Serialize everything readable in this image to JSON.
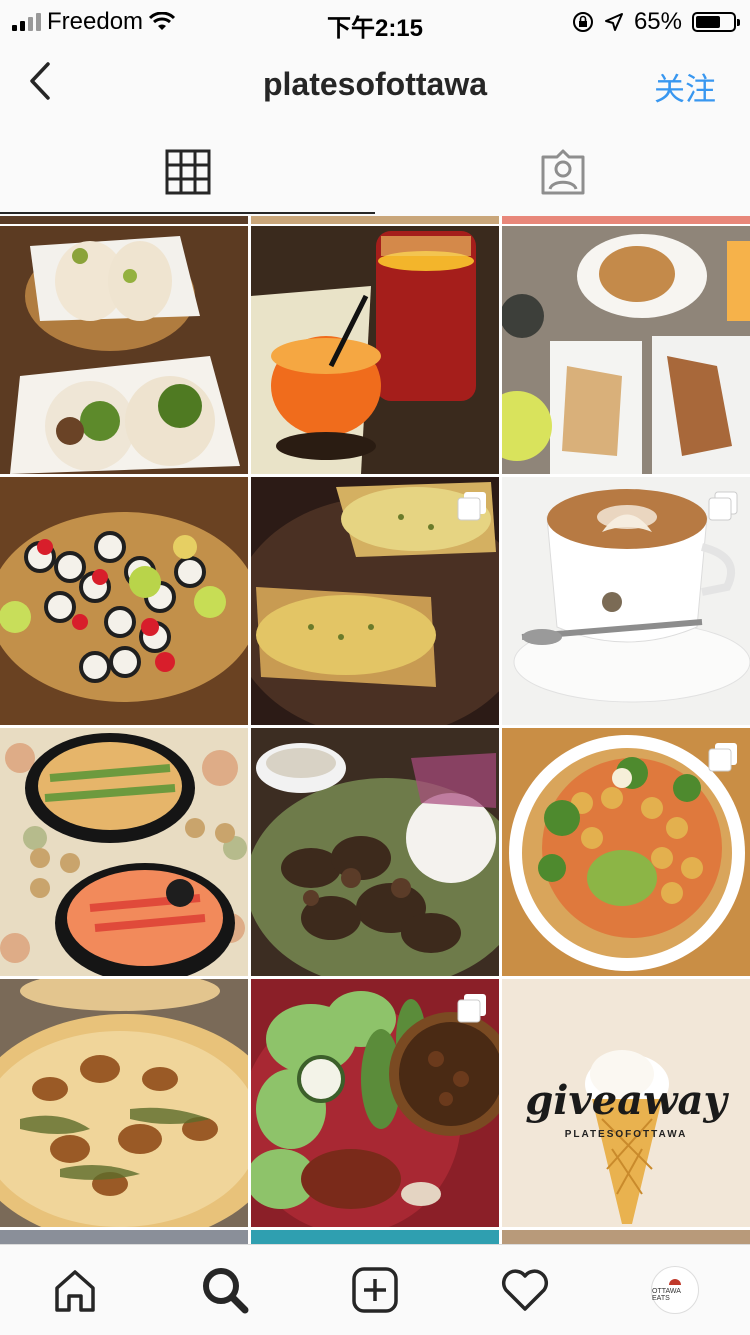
{
  "status_bar": {
    "carrier": "Freedom",
    "time": "下午2:15",
    "battery_percent": "65%"
  },
  "nav": {
    "title": "platesofottawa",
    "follow_label": "关注"
  },
  "posts": [
    {
      "label": "bao buns"
    },
    {
      "label": "drinks"
    },
    {
      "label": "croissant sandwiches"
    },
    {
      "label": "sushi platter"
    },
    {
      "label": "baked dish"
    },
    {
      "label": "latte"
    },
    {
      "label": "sushi trays"
    },
    {
      "label": "grilled meat plate"
    },
    {
      "label": "chickpea bowl"
    },
    {
      "label": "pizza"
    },
    {
      "label": "salad and quiche"
    },
    {
      "label": "giveaway"
    }
  ],
  "giveaway": {
    "script": "giveaway",
    "brand": "PLATESOFOTTAWA"
  },
  "avatar_text": "OTTAWA EATS"
}
